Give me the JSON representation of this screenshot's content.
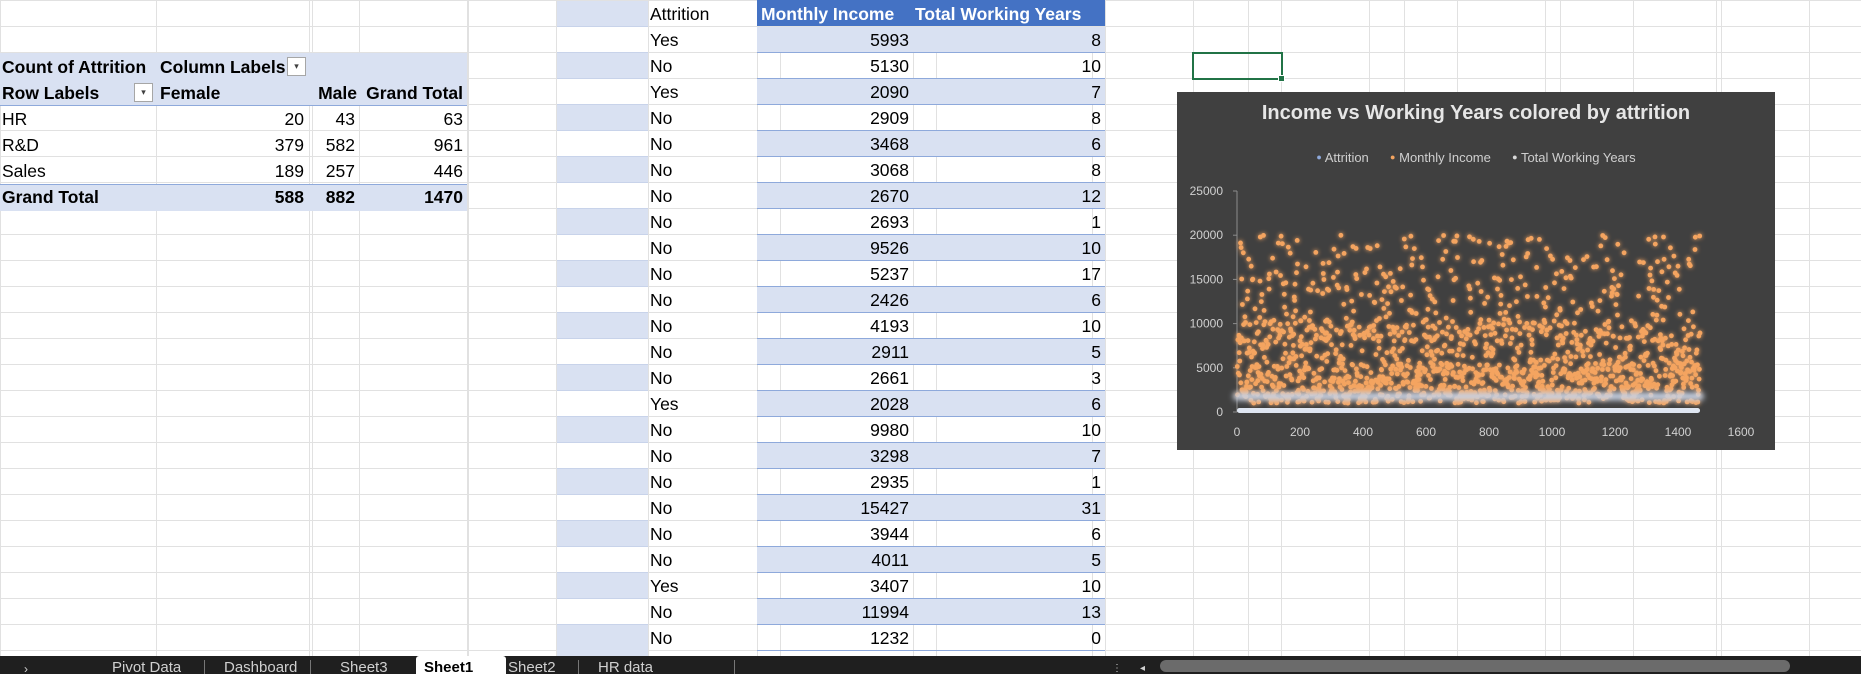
{
  "pivot": {
    "header_left": "Count of Attrition",
    "header_right": "Column Labels",
    "row_labels": "Row Labels",
    "col1": "Female",
    "col2": "Male",
    "col3": "Grand Total",
    "rows": [
      {
        "label": "HR",
        "female": "20",
        "male": "43",
        "total": "63"
      },
      {
        "label": "R&D",
        "female": "379",
        "male": "582",
        "total": "961"
      },
      {
        "label": "Sales",
        "female": "189",
        "male": "257",
        "total": "446"
      }
    ],
    "grand": {
      "label": "Grand Total",
      "female": "588",
      "male": "882",
      "total": "1470"
    }
  },
  "table": {
    "col_attrition": "Attrition",
    "col_income": "Monthly Income",
    "col_years": "Total Working Years",
    "rows": [
      {
        "attrition": "Yes",
        "income": "5993",
        "years": "8"
      },
      {
        "attrition": "No",
        "income": "5130",
        "years": "10"
      },
      {
        "attrition": "Yes",
        "income": "2090",
        "years": "7"
      },
      {
        "attrition": "No",
        "income": "2909",
        "years": "8"
      },
      {
        "attrition": "No",
        "income": "3468",
        "years": "6"
      },
      {
        "attrition": "No",
        "income": "3068",
        "years": "8"
      },
      {
        "attrition": "No",
        "income": "2670",
        "years": "12"
      },
      {
        "attrition": "No",
        "income": "2693",
        "years": "1"
      },
      {
        "attrition": "No",
        "income": "9526",
        "years": "10"
      },
      {
        "attrition": "No",
        "income": "5237",
        "years": "17"
      },
      {
        "attrition": "No",
        "income": "2426",
        "years": "6"
      },
      {
        "attrition": "No",
        "income": "4193",
        "years": "10"
      },
      {
        "attrition": "No",
        "income": "2911",
        "years": "5"
      },
      {
        "attrition": "No",
        "income": "2661",
        "years": "3"
      },
      {
        "attrition": "Yes",
        "income": "2028",
        "years": "6"
      },
      {
        "attrition": "No",
        "income": "9980",
        "years": "10"
      },
      {
        "attrition": "No",
        "income": "3298",
        "years": "7"
      },
      {
        "attrition": "No",
        "income": "2935",
        "years": "1"
      },
      {
        "attrition": "No",
        "income": "15427",
        "years": "31"
      },
      {
        "attrition": "No",
        "income": "3944",
        "years": "6"
      },
      {
        "attrition": "No",
        "income": "4011",
        "years": "5"
      },
      {
        "attrition": "Yes",
        "income": "3407",
        "years": "10"
      },
      {
        "attrition": "No",
        "income": "11994",
        "years": "13"
      },
      {
        "attrition": "No",
        "income": "1232",
        "years": "0"
      }
    ]
  },
  "chart_data": {
    "type": "scatter",
    "title": "Income vs Working Years colored by attrition",
    "legend": [
      "Attrition",
      "Monthly Income",
      "Total Working Years"
    ],
    "legend_position": "top",
    "xlim": [
      0,
      1600
    ],
    "ylim": [
      0,
      25000
    ],
    "x_ticks": [
      "0",
      "200",
      "400",
      "600",
      "800",
      "1000",
      "1200",
      "1400",
      "1600"
    ],
    "y_ticks": [
      "25000",
      "20000",
      "15000",
      "10000",
      "5000",
      "0"
    ],
    "series": [
      {
        "name": "Monthly Income",
        "color": "#f4a460",
        "x": [
          1,
          1470
        ],
        "y": [
          1009,
          19999
        ]
      },
      {
        "name": "Total Working Years",
        "color": "#bfc9d9",
        "x": [
          1,
          1470
        ],
        "y": [
          0,
          40
        ]
      }
    ],
    "colors": {
      "background": "#404040",
      "points": "#f4a460",
      "glow": "#ff7f27",
      "baseline": "#c7d2e4"
    }
  },
  "sheet_tabs": [
    "Pivot Data",
    "Dashboard",
    "Sheet3",
    "Sheet1",
    "Sheet2",
    "HR data"
  ],
  "active_tab": "Sheet1"
}
